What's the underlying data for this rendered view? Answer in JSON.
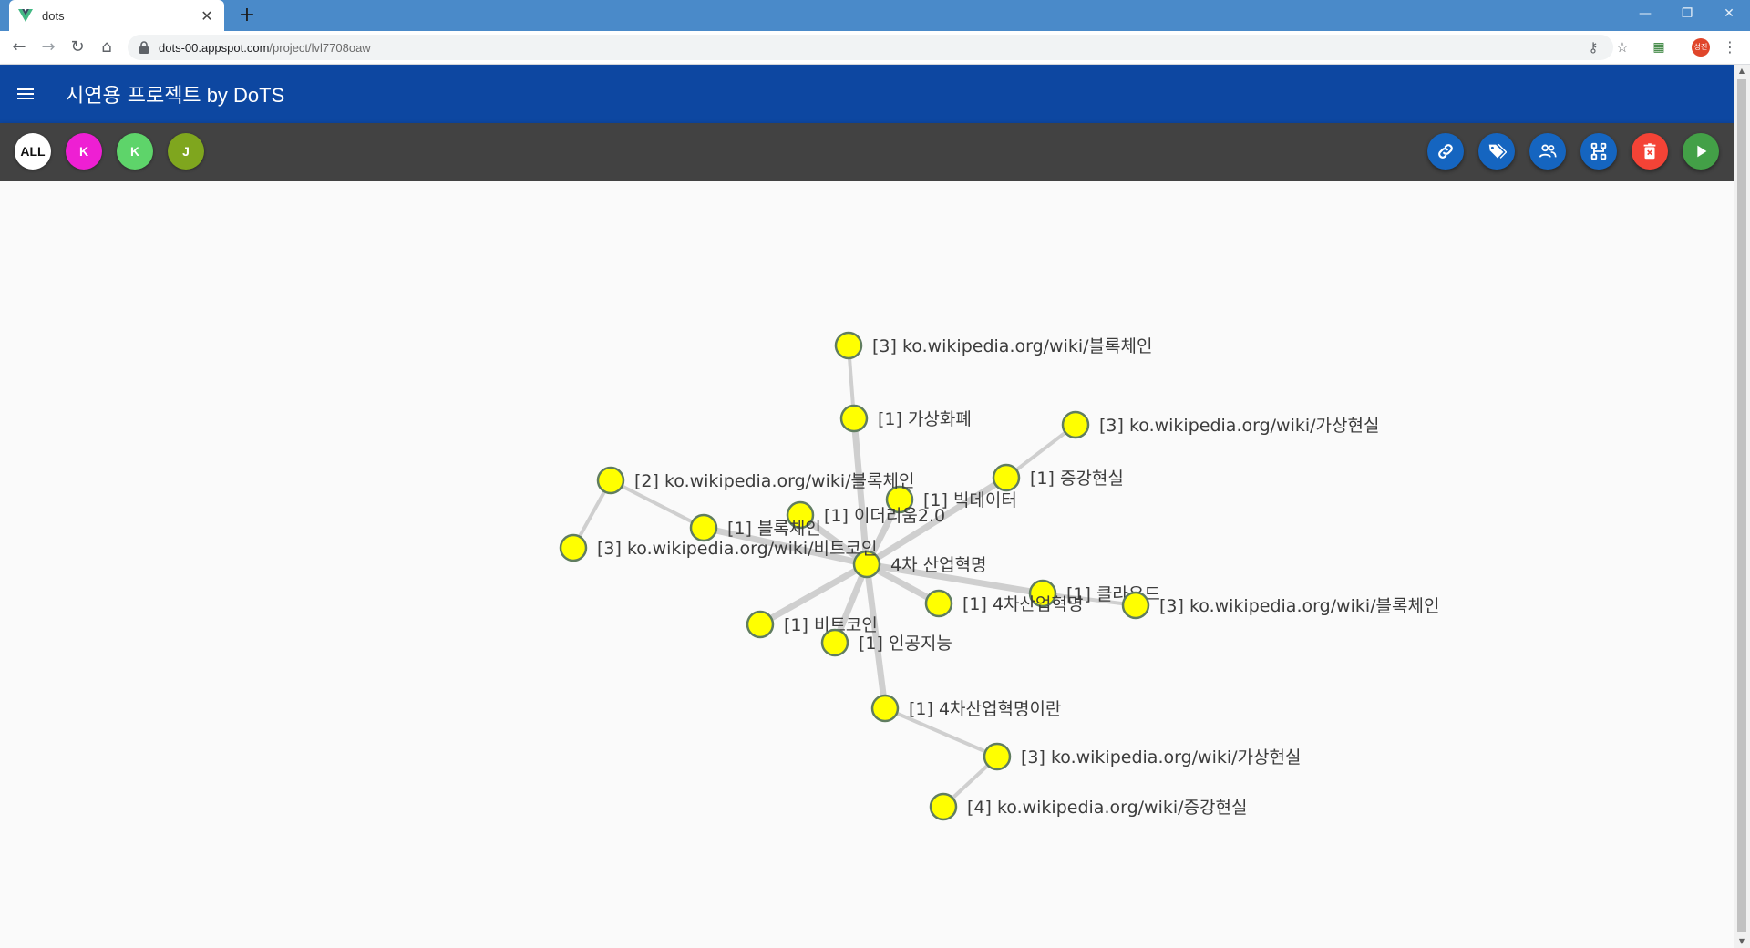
{
  "browser": {
    "tab_title": "dots",
    "url_host": "dots-00.appspot.com",
    "url_path": "/project/lvl7708oaw",
    "profile_initials": "성진"
  },
  "app": {
    "title": "시연용 프로젝트",
    "title_suffix": "by DoTS",
    "colors": {
      "appbar": "#0d47a1",
      "filterbar": "#424242",
      "node_fill": "#ffff00",
      "node_stroke": "#607d60",
      "edge": "#cfcfcf"
    }
  },
  "members": [
    {
      "label": "ALL",
      "color": "#ffffff",
      "text_color": "#111111"
    },
    {
      "label": "K",
      "color": "#ee1fd3",
      "text_color": "#ffffff"
    },
    {
      "label": "K",
      "color": "#5ed46a",
      "text_color": "#ffffff"
    },
    {
      "label": "J",
      "color": "#7fa61e",
      "text_color": "#ffffff"
    }
  ],
  "actions": [
    {
      "name": "link-button",
      "icon": "link-icon",
      "color": "#1565c0"
    },
    {
      "name": "tag-button",
      "icon": "tag-icon",
      "color": "#1565c0"
    },
    {
      "name": "members-button",
      "icon": "group-icon",
      "color": "#1565c0"
    },
    {
      "name": "graph-button",
      "icon": "tree-icon",
      "color": "#1565c0"
    },
    {
      "name": "delete-button",
      "icon": "delete-icon",
      "color": "#f44336"
    },
    {
      "name": "play-button",
      "icon": "play-icon",
      "color": "#43a047"
    }
  ],
  "graph": {
    "nodes": [
      {
        "id": "root",
        "label": "4차 산업혁명"
      },
      {
        "id": "n1",
        "label": "[1] 가상화폐"
      },
      {
        "id": "n2",
        "label": "[3] ko.wikipedia.org/wiki/블록체인"
      },
      {
        "id": "n3",
        "label": "[1] 증강현실"
      },
      {
        "id": "n4",
        "label": "[3] ko.wikipedia.org/wiki/가상현실"
      },
      {
        "id": "n5",
        "label": "[1] 빅데이터"
      },
      {
        "id": "n6",
        "label": "[1] 이더리움2.0"
      },
      {
        "id": "n7",
        "label": "[1] 블록체인"
      },
      {
        "id": "n8",
        "label": "[2] ko.wikipedia.org/wiki/블록체인"
      },
      {
        "id": "n9",
        "label": "[3] ko.wikipedia.org/wiki/비트코인"
      },
      {
        "id": "n10",
        "label": "[1] 클라우드"
      },
      {
        "id": "n11",
        "label": "[3] ko.wikipedia.org/wiki/블록체인"
      },
      {
        "id": "n12",
        "label": "[1] 4차산업혁명"
      },
      {
        "id": "n13",
        "label": "[1] 비트코인"
      },
      {
        "id": "n14",
        "label": "[1] 인공지능"
      },
      {
        "id": "n15",
        "label": "[1] 4차산업혁명이란"
      },
      {
        "id": "n16",
        "label": "[3] ko.wikipedia.org/wiki/가상현실"
      },
      {
        "id": "n17",
        "label": "[4] ko.wikipedia.org/wiki/증강현실"
      }
    ],
    "edges": [
      {
        "from": "root",
        "to": "n1"
      },
      {
        "from": "n1",
        "to": "n2"
      },
      {
        "from": "root",
        "to": "n3"
      },
      {
        "from": "n3",
        "to": "n4"
      },
      {
        "from": "root",
        "to": "n5"
      },
      {
        "from": "root",
        "to": "n6"
      },
      {
        "from": "root",
        "to": "n7"
      },
      {
        "from": "n7",
        "to": "n8"
      },
      {
        "from": "n8",
        "to": "n9"
      },
      {
        "from": "root",
        "to": "n10"
      },
      {
        "from": "n10",
        "to": "n11"
      },
      {
        "from": "root",
        "to": "n12"
      },
      {
        "from": "root",
        "to": "n13"
      },
      {
        "from": "root",
        "to": "n14"
      },
      {
        "from": "root",
        "to": "n15"
      },
      {
        "from": "n15",
        "to": "n16"
      },
      {
        "from": "n16",
        "to": "n17"
      }
    ]
  }
}
